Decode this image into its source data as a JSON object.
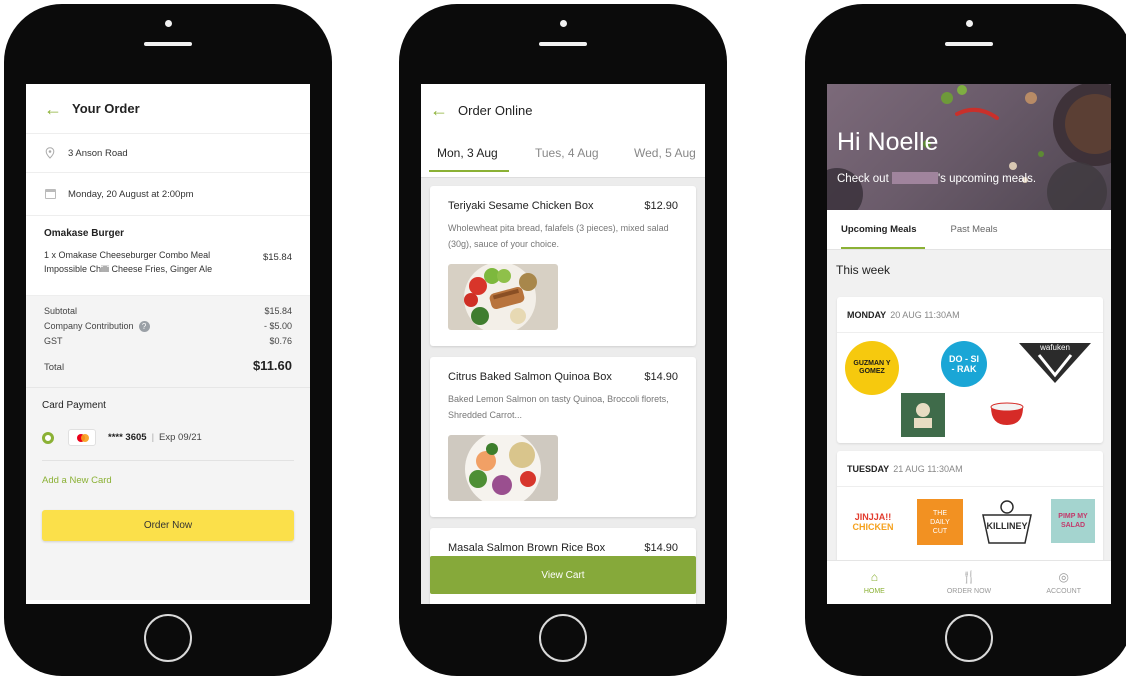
{
  "order_screen": {
    "title": "Your Order",
    "address": "3 Anson Road",
    "delivery_time": "Monday, 20 August at 2:00pm",
    "restaurant": "Omakase Burger",
    "item_line1": "1 x Omakase Cheeseburger Combo Meal",
    "item_line2": "Impossible Chilli Cheese Fries, Ginger Ale",
    "item_price": "$15.84",
    "summary": {
      "subtotal_label": "Subtotal",
      "subtotal_value": "$15.84",
      "contribution_label": "Company Contribution",
      "contribution_value": "- $5.00",
      "gst_label": "GST",
      "gst_value": "$0.76",
      "total_label": "Total",
      "total_value": "$11.60"
    },
    "payment_title": "Card Payment",
    "card_number": "**** 3605",
    "card_sep": "|",
    "card_expiry": "Exp 09/21",
    "add_card": "Add a New Card",
    "order_button": "Order Now"
  },
  "online_screen": {
    "title": "Order Online",
    "tabs": [
      "Mon, 3 Aug",
      "Tues, 4 Aug",
      "Wed, 5 Aug"
    ],
    "meals": [
      {
        "name": "Teriyaki Sesame Chicken Box",
        "price": "$12.90",
        "desc": "Wholewheat pita bread, falafels (3 pieces), mixed salad (30g), sauce of your choice."
      },
      {
        "name": "Citrus Baked Salmon Quinoa Box",
        "price": "$14.90",
        "desc": "Baked Lemon Salmon on tasty Quinoa, Broccoli florets, Shredded Carrot..."
      },
      {
        "name": "Masala Salmon Brown Rice Box",
        "price": "$14.90"
      }
    ],
    "view_cart": "View Cart"
  },
  "home_screen": {
    "greeting": "Hi Noelle",
    "sub_prefix": "Check out",
    "sub_suffix": "'s upcoming meals.",
    "tabs": [
      "Upcoming Meals",
      "Past Meals"
    ],
    "section": "This week",
    "days": [
      {
        "day": "MONDAY",
        "detail": "20 AUG 11:30AM"
      },
      {
        "day": "TUESDAY",
        "detail": "21 AUG 11:30AM"
      }
    ],
    "logos": {
      "guzman": "GUZMAN Y GOMEZ",
      "dosirak": "DO - SI - RAK",
      "wafuken": "wafuken",
      "jinjja_1": "JINJJA!!",
      "jinjja_2": "CHICKEN",
      "daily_cut": "THE DAILY CUT",
      "killiney": "KILLINEY",
      "pimp_my_salad": "PIMP MY SALAD"
    },
    "nav": [
      "HOME",
      "ORDER NOW",
      "ACCOUNT"
    ]
  },
  "colors": {
    "accent": "#8bb135",
    "order_button": "#fbe04a",
    "view_cart": "#86a93a"
  }
}
